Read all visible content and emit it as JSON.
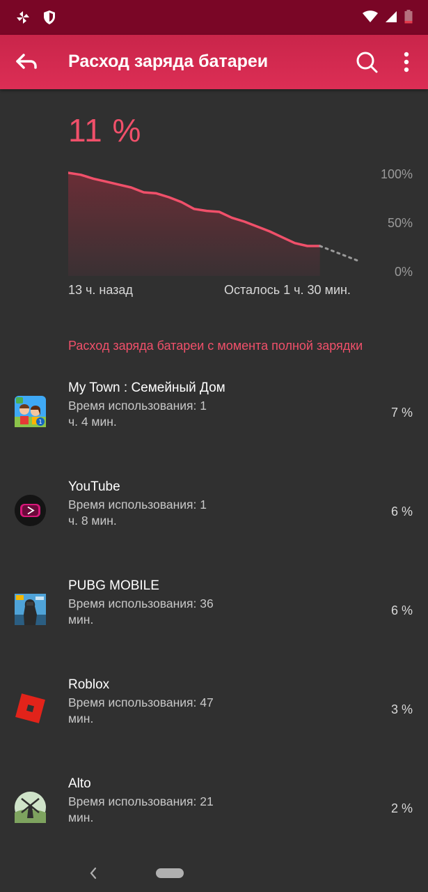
{
  "status_bar": {
    "icons": [
      "pinwheel-icon",
      "shield-icon",
      "wifi-icon",
      "signal-icon",
      "battery-low-icon"
    ]
  },
  "app_bar": {
    "title": "Расход заряда батареи",
    "back_icon": "back-arrow-icon",
    "search_icon": "search-icon",
    "more_icon": "more-vert-icon"
  },
  "battery": {
    "percent_text": "11 %",
    "accent_color": "#f0506a"
  },
  "chart_data": {
    "type": "line",
    "x": [
      0,
      1,
      2,
      3,
      4,
      5,
      6,
      7,
      8,
      9,
      10,
      11,
      12,
      13,
      14,
      15,
      16,
      17,
      18,
      19,
      20
    ],
    "values": [
      100,
      98,
      94,
      91,
      88,
      85,
      80,
      79,
      75,
      70,
      63,
      61,
      60,
      54,
      50,
      45,
      40,
      34,
      28,
      25,
      25
    ],
    "projected": [
      [
        20,
        25
      ],
      [
        23,
        10
      ]
    ],
    "y_tick_labels": [
      "100%",
      "50%",
      "0%"
    ],
    "ylim": [
      0,
      100
    ],
    "x_labels": {
      "start": "13 ч. назад",
      "end": "Осталось 1 ч. 30 мин."
    },
    "line_color": "#f0506a"
  },
  "section_header": "Расход заряда батареи с момента полной зарядки",
  "apps": [
    {
      "name": "My Town : Семейный Дом",
      "usage": "Время использования: 1 ч. 4 мин.",
      "percent": "7 %",
      "icon": "my-town-app-icon"
    },
    {
      "name": "YouTube",
      "usage": "Время использования: 1 ч. 8 мин.",
      "percent": "6 %",
      "icon": "youtube-app-icon"
    },
    {
      "name": "PUBG MOBILE",
      "usage": "Время использования: 36 мин.",
      "percent": "6 %",
      "icon": "pubg-app-icon"
    },
    {
      "name": "Roblox",
      "usage": "Время использования: 47 мин.",
      "percent": "3 %",
      "icon": "roblox-app-icon"
    },
    {
      "name": "Alto",
      "usage": "Время использования: 21 мин.",
      "percent": "2 %",
      "icon": "alto-app-icon"
    }
  ],
  "nav": {
    "back_icon": "nav-back-icon",
    "home": "nav-home-pill"
  }
}
